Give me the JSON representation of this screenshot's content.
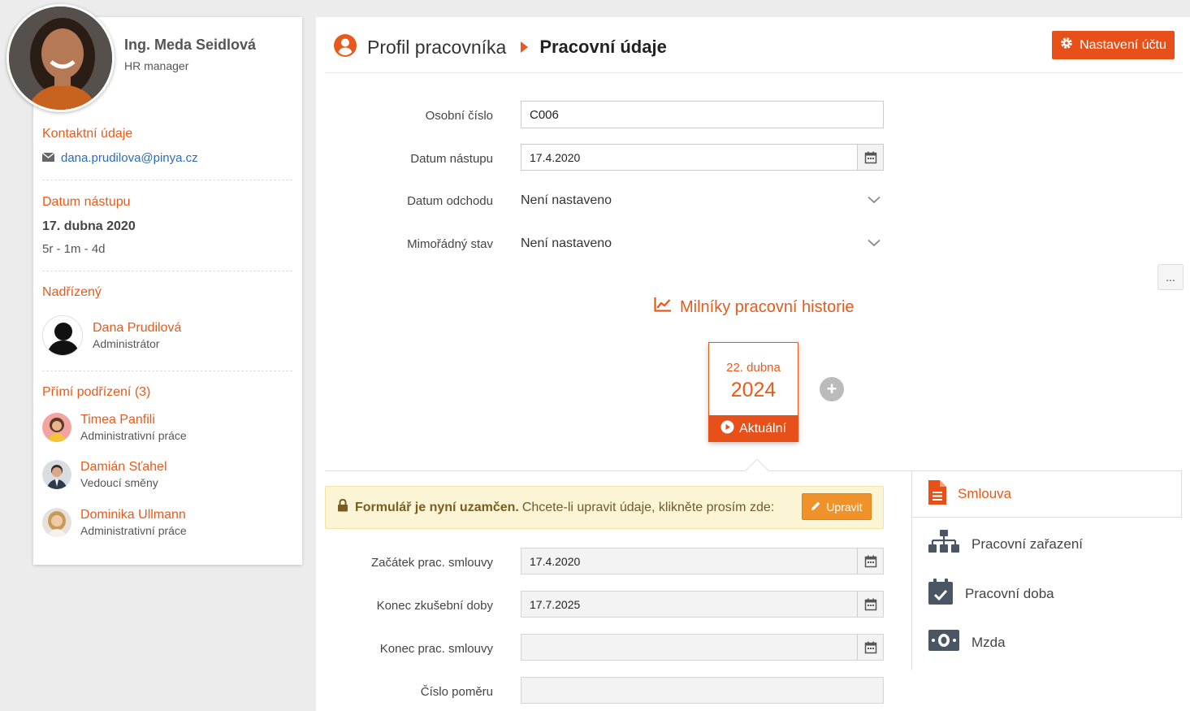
{
  "profile": {
    "name": "Ing. Meda Seidlová",
    "role": "HR manager",
    "contact_title": "Kontaktní údaje",
    "email": "dana.prudilova@pinya.cz",
    "start_title": "Datum nástupu",
    "start_date": "17. dubna 2020",
    "tenure": "5r - 1m - 4d",
    "supervisor_title": "Nadřízený",
    "supervisor": {
      "name": "Dana Prudilová",
      "role": "Administrátor"
    },
    "subordinates_title": "Přímí podřízení (3)",
    "subordinates": [
      {
        "name": "Timea Panfili",
        "role": "Administrativní práce"
      },
      {
        "name": "Damián Sťahel",
        "role": "Vedoucí směny"
      },
      {
        "name": "Dominika Ullmann",
        "role": "Administrativní práce"
      }
    ]
  },
  "header": {
    "breadcrumb_parent": "Profil pracovníka",
    "breadcrumb_current": "Pracovní údaje",
    "settings_label": "Nastavení účtu"
  },
  "form": {
    "personal_number_label": "Osobní číslo",
    "personal_number": "C006",
    "start_label": "Datum nástupu",
    "start_value": "17.4.2020",
    "leave_label": "Datum odchodu",
    "leave_value": "Není nastaveno",
    "special_label": "Mimořádný stav",
    "special_value": "Není nastaveno"
  },
  "more_label": "...",
  "milestones": {
    "title": "Milníky pracovní historie",
    "card_day": "22. dubna",
    "card_year": "2024",
    "card_status": "Aktuální",
    "add_label": "+"
  },
  "lock": {
    "bold": "Formulář je nyní uzamčen.",
    "text": "Chcete-li upravit údaje, klikněte prosím zde:",
    "edit_label": "Upravit"
  },
  "contract": {
    "start_label": "Začátek prac. smlouvy",
    "start_value": "17.4.2020",
    "probation_label": "Konec zkušební doby",
    "probation_value": "17.7.2025",
    "end_label": "Konec prac. smlouvy",
    "end_value": "",
    "number_label": "Číslo poměru",
    "number_value": ""
  },
  "tabs": {
    "contract": "Smlouva",
    "position": "Pracovní zařazení",
    "hours": "Pracovní doba",
    "salary": "Mzda"
  },
  "colors": {
    "accent": "#e85a1b",
    "edit": "#f0922a",
    "lock_bg": "#fbf5d5"
  }
}
